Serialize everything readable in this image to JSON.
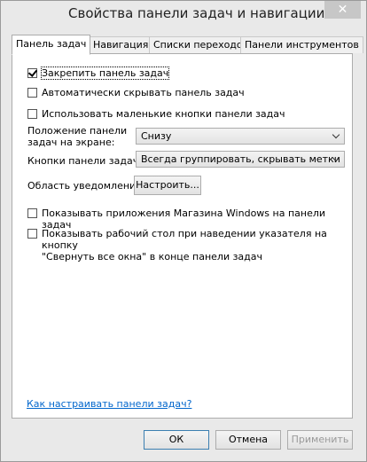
{
  "window": {
    "title": "Свойства панели задач и навигации",
    "close_glyph": "✕"
  },
  "tabs": [
    {
      "label": "Панель задач"
    },
    {
      "label": "Навигация"
    },
    {
      "label": "Списки переходов"
    },
    {
      "label": "Панели инструментов"
    }
  ],
  "options": {
    "lock": {
      "label": "Закрепить панель задач",
      "checked": true
    },
    "autohide": {
      "label": "Автоматически скрывать панель задач",
      "checked": false
    },
    "small": {
      "label": "Использовать маленькие кнопки панели задач",
      "checked": false
    },
    "store": {
      "label": "Показывать приложения Магазина Windows на панели задач",
      "checked": false
    },
    "peek": {
      "label_line1": "Показывать рабочий стол при наведении указателя на кнопку",
      "label_line2": "\"Свернуть все окна\" в конце панели задач",
      "checked": false
    }
  },
  "position": {
    "label_line1": "Положение панели",
    "label_line2": "задач на экране:",
    "value": "Снизу"
  },
  "buttons_setting": {
    "label": "Кнопки панели задач:",
    "value": "Всегда группировать, скрывать метки"
  },
  "notify": {
    "label": "Область уведомлений:",
    "button": "Настроить..."
  },
  "help_link": "Как настраивать панели задач?",
  "footer": {
    "ok": "ОК",
    "cancel": "Отмена",
    "apply": "Применить"
  }
}
